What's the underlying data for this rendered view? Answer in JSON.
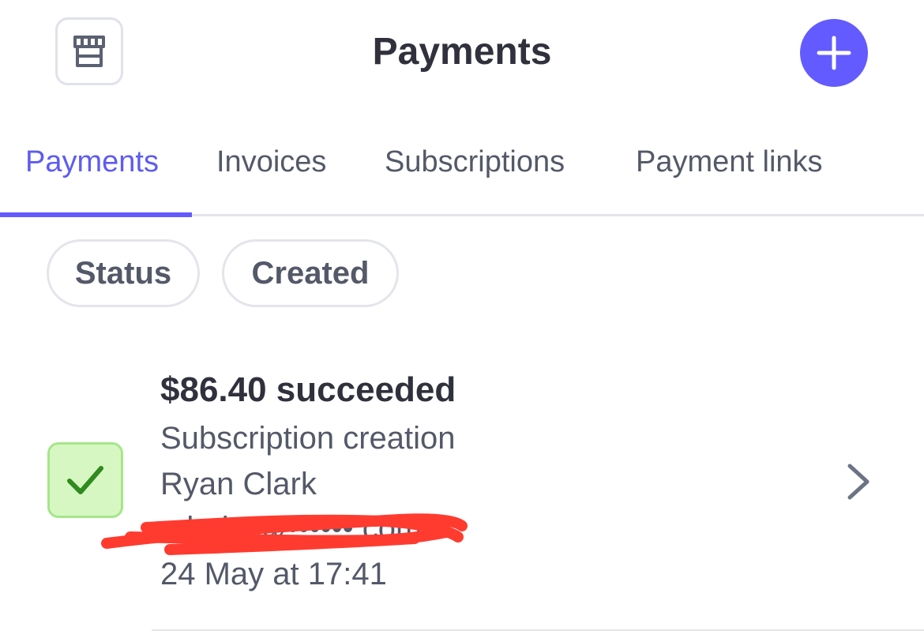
{
  "header": {
    "title": "Payments",
    "store_icon": "storefront-icon",
    "add_icon": "plus-icon",
    "add_button_color": "#635bff"
  },
  "tabs": [
    {
      "label": "Payments",
      "active": true
    },
    {
      "label": "Invoices",
      "active": false
    },
    {
      "label": "Subscriptions",
      "active": false
    },
    {
      "label": "Payment links",
      "active": false
    }
  ],
  "filters": [
    {
      "label": "Status"
    },
    {
      "label": "Created"
    }
  ],
  "payments": [
    {
      "amount_status": "$86.40 succeeded",
      "description": "Subscription creation",
      "customer": "Ryan Clark",
      "email": "rclarke@••••••.com",
      "date": "24 May at 17:41",
      "status_icon": "checkmark-icon",
      "status_color": "#d7f7c2"
    }
  ],
  "colors": {
    "accent": "#635bff",
    "success": "#2f8a1f",
    "redaction": "#ff3b30"
  }
}
